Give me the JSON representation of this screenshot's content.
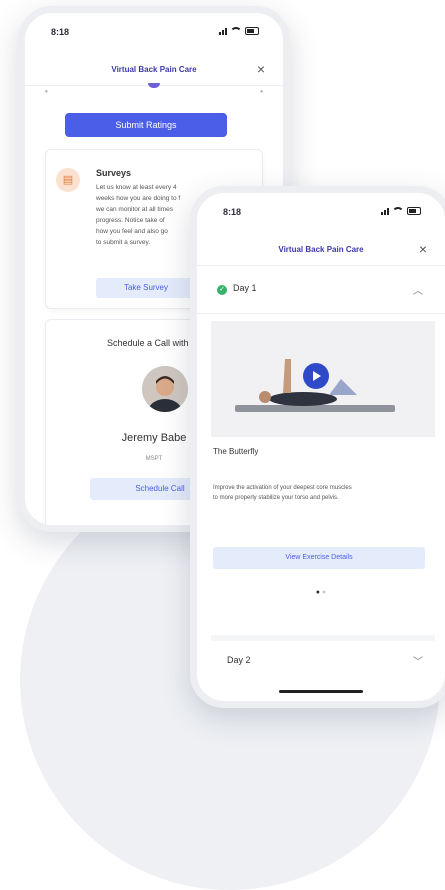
{
  "phone_left": {
    "status_time": "8:18",
    "nav_title": "Virtual Back Pain Care",
    "close_label": "×",
    "submit_label": "Submit Ratings",
    "survey": {
      "icon_glyph": "▤",
      "title": "Surveys",
      "body": "Let us know at least every 4\nweeks how you are doing to f\nwe can monitor at all times\nprogress. Notice take of \nhow you feel and also go\nto submit a survey.",
      "button": "Take Survey"
    },
    "schedule": {
      "title": "Schedule a Call with Yo",
      "coach_name": "Jeremy Babe",
      "coach_role": "MSPT",
      "button": "Schedule Call"
    }
  },
  "phone_right": {
    "status_time": "8:18",
    "nav_title": "Virtual Back Pain Care",
    "close_label": "×",
    "day1_label": "Day 1",
    "exercise_name": "The Butterfly",
    "exercise_desc": "Improve the activation of your deepest core muscles\nto more properly stabilize your torso and pelvis.",
    "view_button": "View Exercise Details",
    "day2_label": "Day 2"
  },
  "colors": {
    "primary": "#4a5ee8",
    "nav_title": "#3d3aa8",
    "success": "#37b26c",
    "soft_button_bg": "#e4ebfb",
    "survey_icon_bg": "#fbe2d0",
    "play_button": "#3049c7"
  },
  "icons": {
    "survey": "clipboard-icon",
    "check": "checkmark-circle-icon",
    "play": "play-icon",
    "chevron_up": "chevron-up-icon",
    "chevron_down": "chevron-down-icon"
  }
}
